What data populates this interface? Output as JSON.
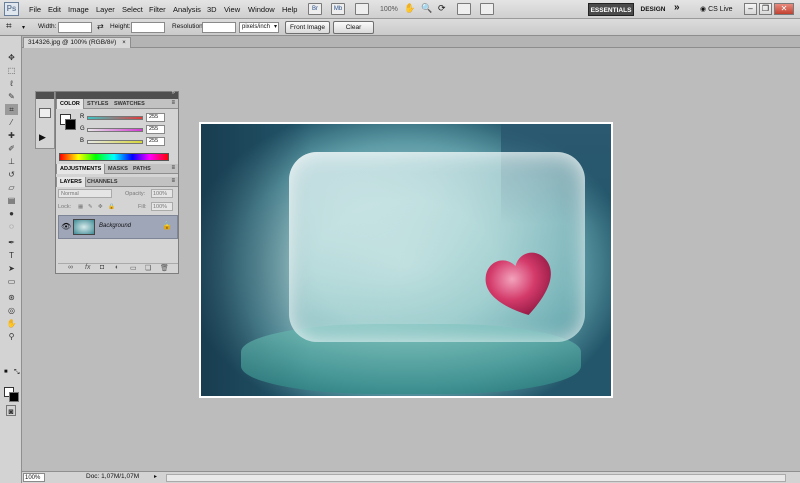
{
  "app": {
    "logo": "Ps"
  },
  "menubar": {
    "items": [
      "File",
      "Edit",
      "Image",
      "Layer",
      "Select",
      "Filter",
      "Analysis",
      "3D",
      "View",
      "Window",
      "Help"
    ],
    "icons": [
      "bridge-icon",
      "minibridge-icon",
      "view-extras-icon",
      "zoom-icon",
      "hand-icon",
      "rotate-icon",
      "arrange-icon",
      "screen-mode-icon"
    ],
    "zoom": "100%",
    "workspaces": {
      "active": "ESSENTIALS",
      "other": "DESIGN",
      "more": "»"
    },
    "cs_live": "CS Live"
  },
  "options": {
    "width_label": "Width:",
    "height_label": "Height:",
    "resolution_label": "Resolution:",
    "resolution_unit": "pixels/inch",
    "front_image": "Front Image",
    "clear": "Clear"
  },
  "document": {
    "tab_title": "314326.jpg @ 100% (RGB/8#)",
    "close": "×"
  },
  "color_panel": {
    "tabs": [
      "COLOR",
      "STYLES",
      "SWATCHES"
    ],
    "channels": [
      {
        "label": "R",
        "value": "255",
        "color": "#e23b3b"
      },
      {
        "label": "G",
        "value": "255",
        "color": "#d33ad3"
      },
      {
        "label": "B",
        "value": "255",
        "color": "#d6d63a"
      }
    ]
  },
  "adjust_panel": {
    "tabs": [
      "ADJUSTMENTS",
      "MASKS",
      "PATHS"
    ]
  },
  "layers_panel": {
    "tabs": [
      "LAYERS",
      "CHANNELS"
    ],
    "blend_mode": "Normal",
    "opacity_label": "Opacity:",
    "opacity": "100%",
    "lock_label": "Lock:",
    "fill_label": "Fill:",
    "fill": "100%",
    "layer_name": "Background"
  },
  "status": {
    "zoom": "100%",
    "doc_info": "Doc: 1,07M/1,07M"
  }
}
